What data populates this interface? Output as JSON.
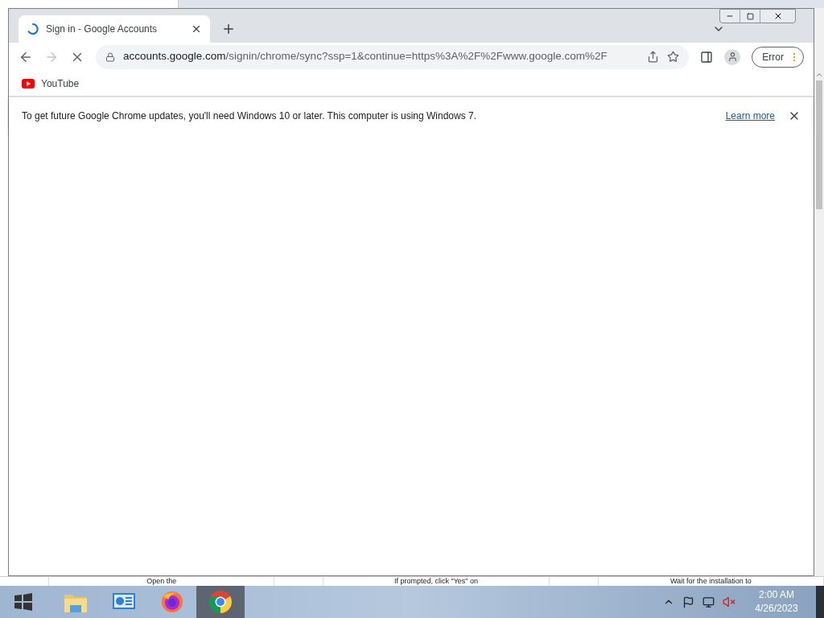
{
  "browser": {
    "tabs": [
      {
        "title": "Sign in - Google Accounts",
        "selected": true,
        "loading": true
      }
    ],
    "toolbar": {
      "forward_disabled": true,
      "loading": true,
      "url_host": "accounts.google.com",
      "url_path": "/signin/chrome/sync?ssp=1&continue=https%3A%2F%2Fwww.google.com%2F",
      "profile_status": "Error"
    },
    "bookmarks": [
      {
        "label": "YouTube"
      }
    ],
    "infobar": {
      "message": "To get future Google Chrome updates, you'll need Windows 10 or later. This computer is using Windows 7.",
      "link": "Learn more"
    }
  },
  "background_page": {
    "steps": [
      "Open the",
      "If prompted, click \"Yes\" on",
      "Wait for the installation to"
    ]
  },
  "taskbar": {
    "apps": [
      {
        "kind": "explorer",
        "selected": false
      },
      {
        "kind": "control-panel",
        "selected": false
      },
      {
        "kind": "firefox",
        "selected": false
      },
      {
        "kind": "chrome",
        "selected": true
      }
    ],
    "clock": {
      "time": "2:00 AM",
      "date": "4/26/2023"
    }
  }
}
